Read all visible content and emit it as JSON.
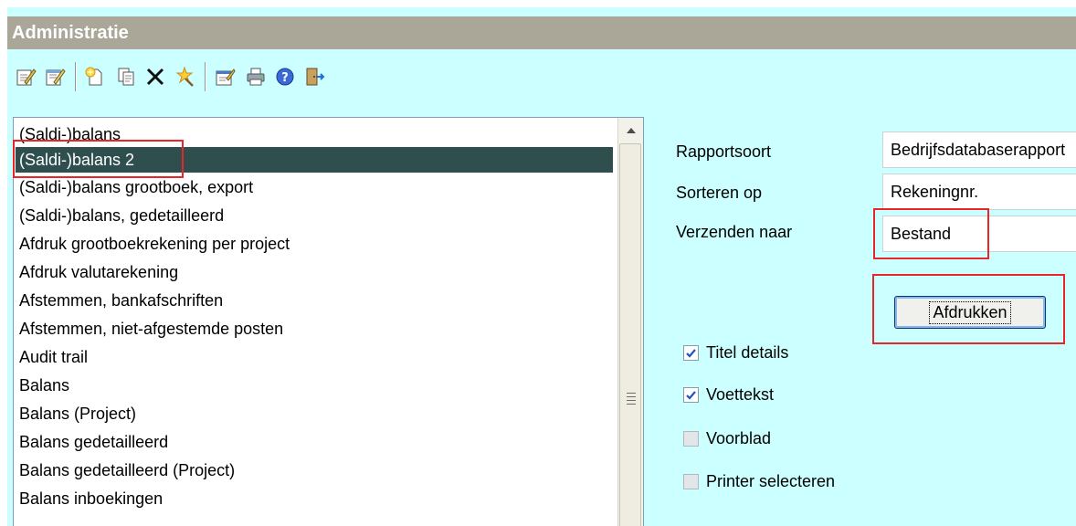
{
  "window": {
    "title": "Administratie"
  },
  "toolbar": {
    "buttons": [
      {
        "name": "edit-icon"
      },
      {
        "name": "edit-alt-icon"
      },
      {
        "name": "new-icon"
      },
      {
        "name": "copy-icon"
      },
      {
        "name": "delete-icon"
      },
      {
        "name": "wizard-icon"
      },
      {
        "name": "properties-icon"
      },
      {
        "name": "print-icon"
      },
      {
        "name": "help-icon"
      },
      {
        "name": "exit-icon"
      }
    ]
  },
  "report_list": {
    "items": [
      "(Saldi-)balans",
      "(Saldi-)balans 2",
      "(Saldi-)balans grootboek, export",
      "(Saldi-)balans, gedetailleerd",
      "Afdruk grootboekrekening per project",
      "Afdruk valutarekening",
      "Afstemmen, bankafschriften",
      "Afstemmen, niet-afgestemde posten",
      "Audit trail",
      "Balans",
      "Balans (Project)",
      "Balans gedetailleerd",
      "Balans gedetailleerd (Project)",
      "Balans inboekingen"
    ],
    "selected": "(Saldi-)balans 2"
  },
  "form": {
    "report_type_label": "Rapportsoort",
    "report_type_value": "Bedrijfsdatabaserapport",
    "sort_label": "Sorteren op",
    "sort_value": "Rekeningnr.",
    "send_label": "Verzenden naar",
    "send_value": "Bestand",
    "print_button": "Afdrukken",
    "checkboxes": [
      {
        "label": "Titel details",
        "checked": true
      },
      {
        "label": "Voettekst",
        "checked": true
      },
      {
        "label": "Voorblad",
        "checked": false
      },
      {
        "label": "Printer selecteren",
        "checked": false
      }
    ]
  },
  "colors": {
    "background": "#ccffff",
    "title_bar": "#aaa799",
    "selection": "#2f4f4f",
    "highlight_box": "#e8262a"
  }
}
